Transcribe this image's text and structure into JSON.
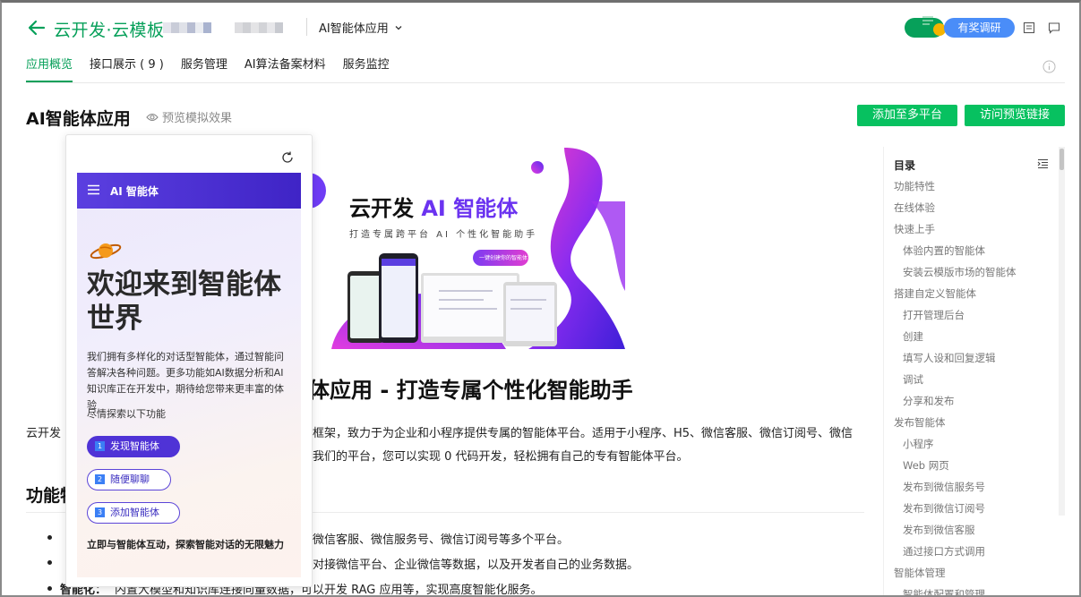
{
  "header": {
    "brand": "云开发·云模板",
    "app_selector": "AI智能体应用",
    "survey_label": "有奖调研",
    "accent": "#07a05a"
  },
  "tabs": [
    {
      "label": "应用概览",
      "active": true
    },
    {
      "label": "接口展示 ( 9 )",
      "active": false
    },
    {
      "label": "服务管理",
      "active": false
    },
    {
      "label": "AI算法备案材料",
      "active": false
    },
    {
      "label": "服务监控",
      "active": false
    }
  ],
  "page": {
    "title": "AI智能体应用",
    "preview_link": "预览模拟效果",
    "add_platform_button": "添加至多平台",
    "visit_preview_button": "访问预览链接"
  },
  "banner": {
    "title_prefix": "云开发",
    "title_highlight": "AI 智能体",
    "subtitle": "打造专属跨平台 AI 个性化智能助手",
    "pill": "一键创建你的智能体"
  },
  "doc": {
    "heading": "体应用 - 打造专属个性化智能助手",
    "para_line1_a": "云开发",
    "para_line1_b": "框架，致力于为企业和小程序提供专属的智能体平台。适用于小程序、H5、微信客服、微信订阅号、微信",
    "para_line2": "我们的平台，您可以实现 0 代码开发，轻松拥有自己的专有智能体平台。",
    "section_heading": "功能特",
    "bullets": [
      "微信客服、微信服务号、微信订阅号等多个平台。",
      "对接微信平台、企业微信等数据，以及开发者自己的业务数据。",
      "内置大模型和知识库连接向量数据，可以开发 RAG 应用等，实现高度智能化服务。"
    ],
    "bullet3_label": "智能化："
  },
  "toc": {
    "title": "目录",
    "items": [
      {
        "label": "功能特性",
        "level": 1
      },
      {
        "label": "在线体验",
        "level": 1
      },
      {
        "label": "快速上手",
        "level": 1
      },
      {
        "label": "体验内置的智能体",
        "level": 2
      },
      {
        "label": "安装云模版市场的智能体",
        "level": 2
      },
      {
        "label": "搭建自定义智能体",
        "level": 1
      },
      {
        "label": "打开管理后台",
        "level": 2
      },
      {
        "label": "创建",
        "level": 2
      },
      {
        "label": "填写人设和回复逻辑",
        "level": 2
      },
      {
        "label": "调试",
        "level": 2
      },
      {
        "label": "分享和发布",
        "level": 2
      },
      {
        "label": "发布智能体",
        "level": 1
      },
      {
        "label": "小程序",
        "level": 2
      },
      {
        "label": "Web 网页",
        "level": 2
      },
      {
        "label": "发布到微信服务号",
        "level": 2
      },
      {
        "label": "发布到微信订阅号",
        "level": 2
      },
      {
        "label": "发布到微信客服",
        "level": 2
      },
      {
        "label": "通过接口方式调用",
        "level": 2
      },
      {
        "label": "智能体管理",
        "level": 1
      },
      {
        "label": "智能体配置和管理",
        "level": 2
      }
    ]
  },
  "phone": {
    "bar_title": "AI 智能体",
    "welcome": "欢迎来到智能体世界",
    "intro": "我们拥有多样化的对话型智能体，通过智能问答解决各种问题。更多功能如AI数据分析和AI知识库正在开发中，期待给您带来更丰富的体验",
    "explore": "尽情探索以下功能",
    "buttons": [
      {
        "num": "1",
        "label": "发现智能体"
      },
      {
        "num": "2",
        "label": "随便聊聊"
      },
      {
        "num": "3",
        "label": "添加智能体"
      }
    ],
    "tagline": "立即与智能体互动，探索智能对话的无限魅力"
  }
}
